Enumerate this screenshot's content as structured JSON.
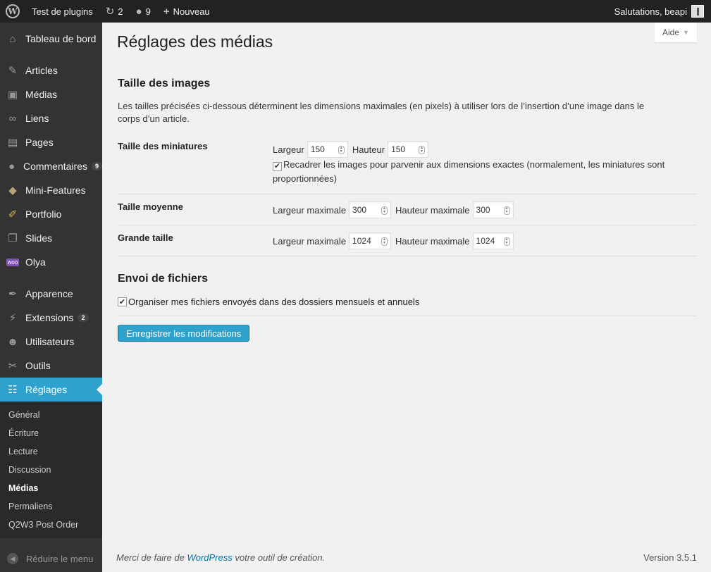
{
  "adminbar": {
    "site_name": "Test de plugins",
    "updates_count": "2",
    "comments_count": "9",
    "new_label": "Nouveau",
    "greeting": "Salutations, beapi"
  },
  "sidebar": {
    "items": [
      {
        "label": "Tableau de bord",
        "icon": "dashboard-icon"
      },
      {
        "label": "Articles",
        "icon": "pin-icon"
      },
      {
        "label": "Médias",
        "icon": "media-icon"
      },
      {
        "label": "Liens",
        "icon": "link-icon"
      },
      {
        "label": "Pages",
        "icon": "page-icon"
      },
      {
        "label": "Commentaires",
        "icon": "comment-icon",
        "count": "9"
      },
      {
        "label": "Mini-Features",
        "icon": "box-icon"
      },
      {
        "label": "Portfolio",
        "icon": "brush-icon"
      },
      {
        "label": "Slides",
        "icon": "slides-icon"
      },
      {
        "label": "Olya",
        "icon": "woo-icon"
      },
      {
        "label": "Apparence",
        "icon": "appearance-icon"
      },
      {
        "label": "Extensions",
        "icon": "plugin-icon",
        "count": "2"
      },
      {
        "label": "Utilisateurs",
        "icon": "user-icon"
      },
      {
        "label": "Outils",
        "icon": "wrench-icon"
      },
      {
        "label": "Réglages",
        "icon": "settings-icon"
      }
    ],
    "submenu": [
      "Général",
      "Écriture",
      "Lecture",
      "Discussion",
      "Médias",
      "Permaliens",
      "Q2W3 Post Order"
    ],
    "collapse_label": "Réduire le menu"
  },
  "page": {
    "help_label": "Aide",
    "title": "Réglages des médias",
    "section_images": "Taille des images",
    "description": "Les tailles précisées ci-dessous déterminent les dimensions maximales (en pixels) à utiliser lors de l’insertion d’une image dans le corps d’un article.",
    "thumbnail": {
      "label": "Taille des miniatures",
      "width_label": "Largeur",
      "width": "150",
      "height_label": "Hauteur",
      "height": "150",
      "crop_label": "Recadrer les images pour parvenir aux dimensions exactes (normalement, les miniatures sont proportionnées)",
      "crop_checked": true
    },
    "medium": {
      "label": "Taille moyenne",
      "width_label": "Largeur maximale",
      "width": "300",
      "height_label": "Hauteur maximale",
      "height": "300"
    },
    "large": {
      "label": "Grande taille",
      "width_label": "Largeur maximale",
      "width": "1024",
      "height_label": "Hauteur maximale",
      "height": "1024"
    },
    "section_uploads": "Envoi de fichiers",
    "uploads_label": "Organiser mes fichiers envoyés dans des dossiers mensuels et annuels",
    "uploads_checked": true,
    "save_label": "Enregistrer les modifications"
  },
  "footer": {
    "thanks_before": "Merci de faire de ",
    "thanks_link": "WordPress",
    "thanks_after": " votre outil de création.",
    "version": "Version 3.5.1"
  },
  "colors": {
    "accent": "#2ea2cc",
    "sidebar_bg": "#333333",
    "adminbar_bg": "#222222"
  }
}
